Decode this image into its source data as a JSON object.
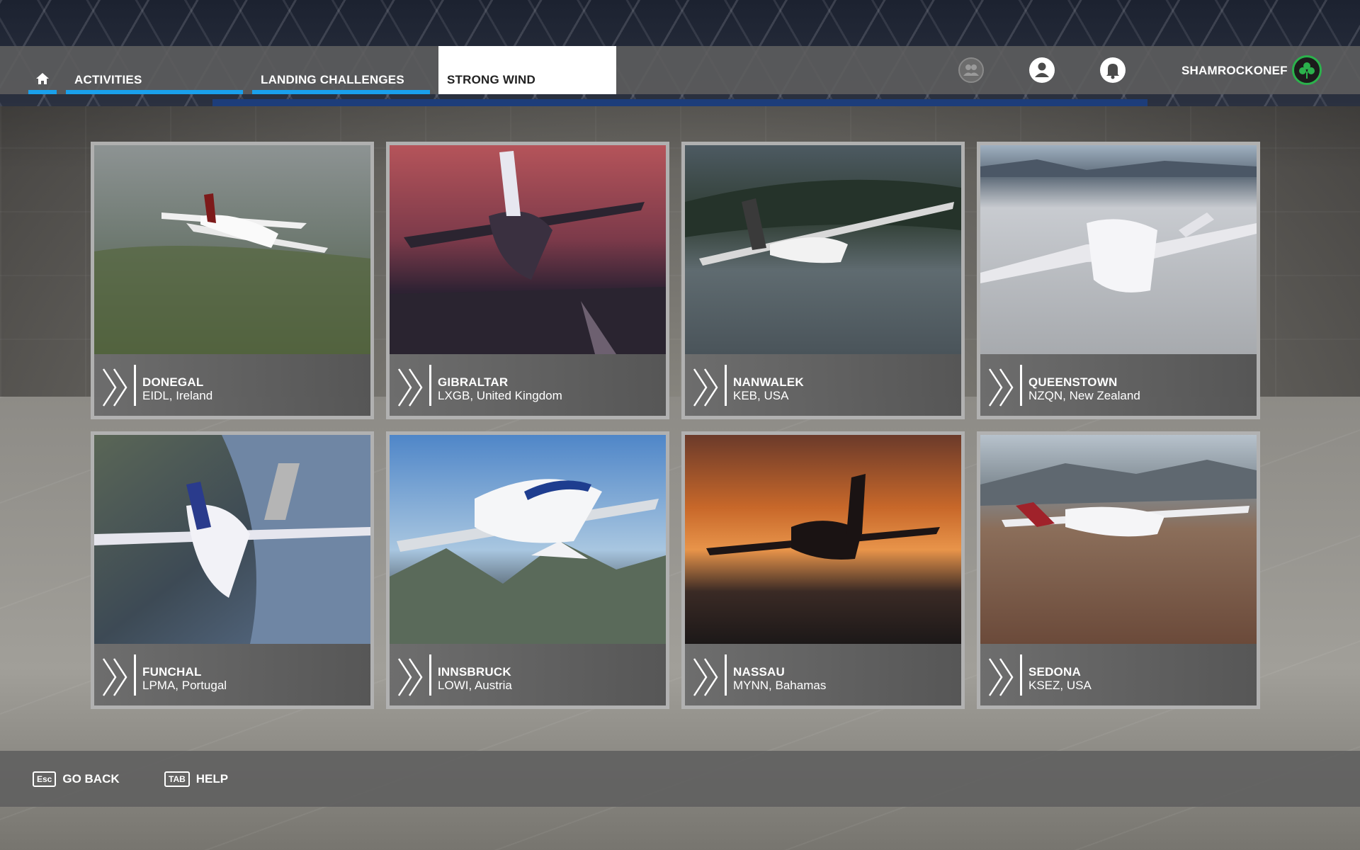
{
  "nav": {
    "tabs": [
      {
        "label": "ACTIVITIES"
      },
      {
        "label": "LANDING CHALLENGES"
      },
      {
        "label": "STRONG WIND"
      }
    ],
    "active_color": "#1aa0ec"
  },
  "user": {
    "name": "SHAMROCKONEF",
    "accent_color": "#2bb24c",
    "icons": [
      "friends-icon",
      "profile-icon",
      "notifications-icon"
    ]
  },
  "cards": [
    {
      "city": "DONEGAL",
      "code": "EIDL, Ireland"
    },
    {
      "city": "GIBRALTAR",
      "code": "LXGB, United Kingdom"
    },
    {
      "city": "NANWALEK",
      "code": "KEB, USA"
    },
    {
      "city": "QUEENSTOWN",
      "code": "NZQN, New Zealand"
    },
    {
      "city": "FUNCHAL",
      "code": "LPMA, Portugal"
    },
    {
      "city": "INNSBRUCK",
      "code": "LOWI, Austria"
    },
    {
      "city": "NASSAU",
      "code": "MYNN, Bahamas"
    },
    {
      "city": "SEDONA",
      "code": "KSEZ, USA"
    }
  ],
  "footer": {
    "back": {
      "key": "Esc",
      "label": "GO BACK"
    },
    "help": {
      "key": "TAB",
      "label": "HELP"
    }
  }
}
